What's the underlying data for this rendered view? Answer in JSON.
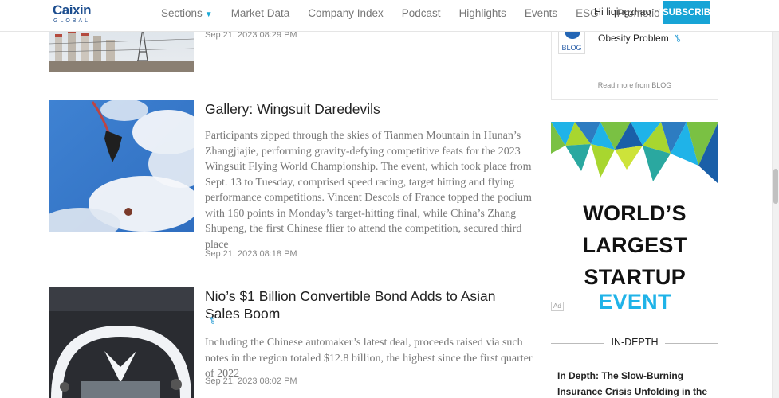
{
  "header": {
    "logo_main": "Caixin",
    "logo_sub": "GLOBAL",
    "nav": [
      {
        "label": "Sections"
      },
      {
        "label": "Market Data"
      },
      {
        "label": "Company Index"
      },
      {
        "label": "Podcast"
      },
      {
        "label": "Highlights"
      },
      {
        "label": "Events"
      },
      {
        "label": "ESG"
      },
      {
        "label": "Promotio"
      }
    ],
    "user_greeting": "Hi liqingzhao",
    "subscribe_label": "SUBSCRIBE"
  },
  "articles": [
    {
      "time": "Sep 21, 2023 08:29 PM"
    },
    {
      "title": "Gallery: Wingsuit Daredevils",
      "summary": "Participants zipped through the skies of Tianmen Mountain in Hunan’s Zhangjiajie, performing gravity-defying competitive feats for the 2023 Wingsuit Flying World Championship. The event, which took place from Sept. 13 to Tuesday, comprised speed racing, target hitting and flying performance competitions. Vincent Descols of France topped the podium with 160 points in Monday’s target-hitting final, while China’s Zhang Shupeng, the first Chinese flier to attend the competition, secured third place",
      "time": "Sep 21, 2023 08:18 PM"
    },
    {
      "title": "Nio’s $1 Billion Convertible Bond Adds to Asian Sales Boom",
      "summary": "Including the Chinese automaker’s latest deal, proceeds raised via such notes in the region totaled $12.8 billion, the highest since the first quarter of 2022",
      "time": "Sep 21, 2023 08:02 PM"
    }
  ],
  "sidebar": {
    "blog": {
      "avatar_label": "BLOG",
      "title": "Obesity Problem",
      "read_more": "Read more from BLOG"
    },
    "ad": {
      "line1": "WORLD’S",
      "line2": "LARGEST",
      "line3_a": "STARTUP",
      "line3_b": "EVENT",
      "badge": "Ad"
    },
    "indepth": {
      "heading": "IN-DEPTH",
      "title": "In Depth: The Slow-Burning Insurance Crisis Unfolding in the Shadows"
    }
  },
  "colors": {
    "accent": "#17a4d6",
    "brand": "#1d4e8f"
  }
}
